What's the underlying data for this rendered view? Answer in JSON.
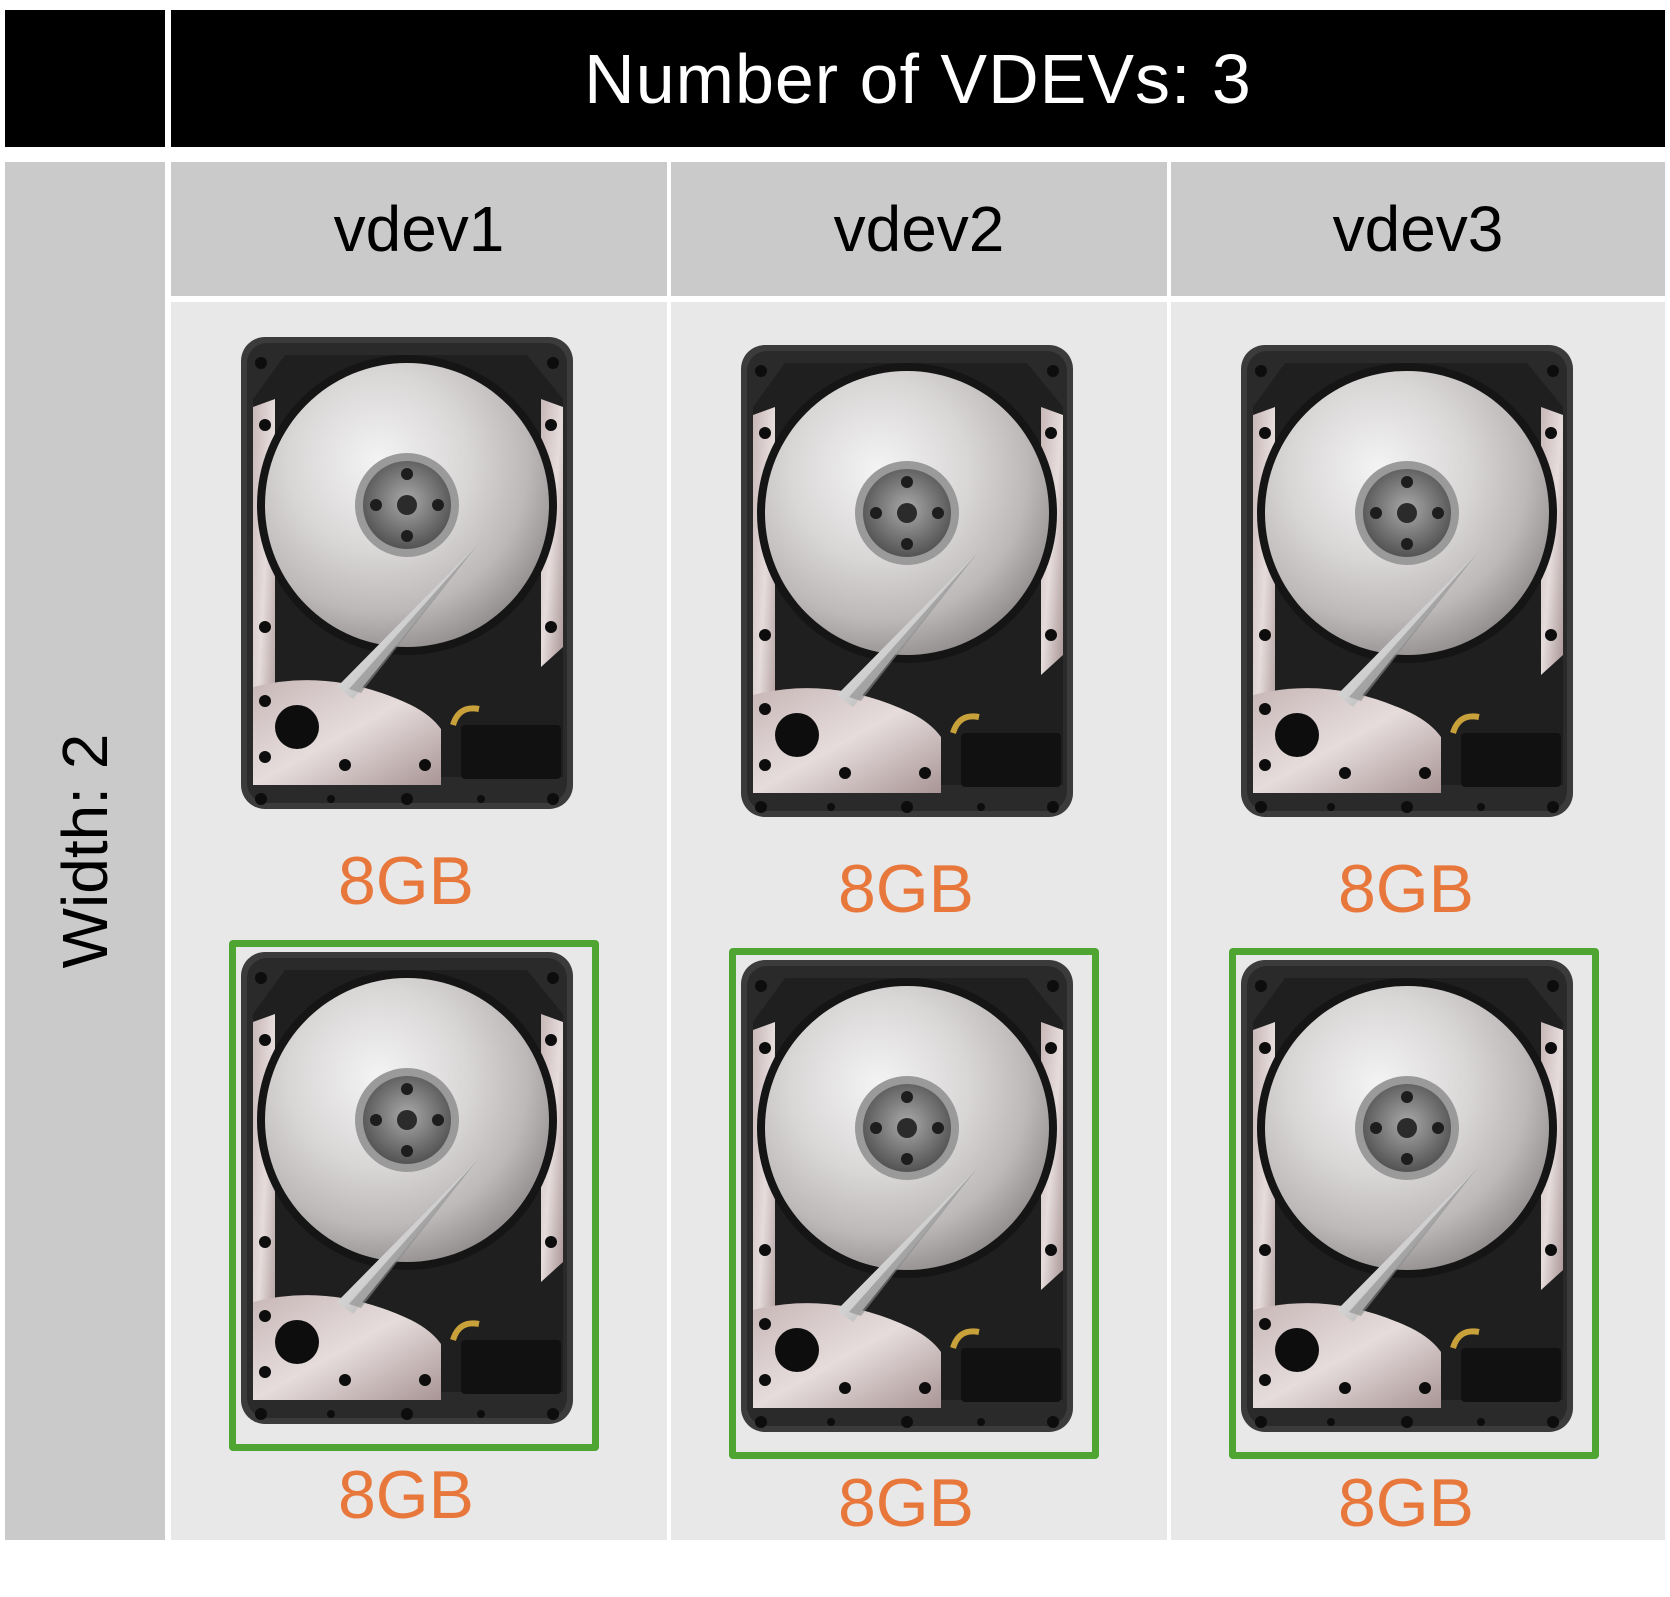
{
  "title": "Number of VDEVs: 3",
  "width_label": "Width: 2",
  "vdevs": [
    {
      "name": "vdev1",
      "disks": [
        {
          "capacity": "8GB"
        },
        {
          "capacity": "8GB"
        }
      ]
    },
    {
      "name": "vdev2",
      "disks": [
        {
          "capacity": "8GB"
        },
        {
          "capacity": "8GB"
        }
      ]
    },
    {
      "name": "vdev3",
      "disks": [
        {
          "capacity": "8GB"
        },
        {
          "capacity": "8GB"
        }
      ]
    }
  ],
  "colors": {
    "header": "#000000",
    "side": "#cacaca",
    "column_body": "#e8e8e8",
    "capacity_text": "#e8773c",
    "selection_border": "#4fa532"
  },
  "icons": [
    "hard-drive-icon"
  ]
}
